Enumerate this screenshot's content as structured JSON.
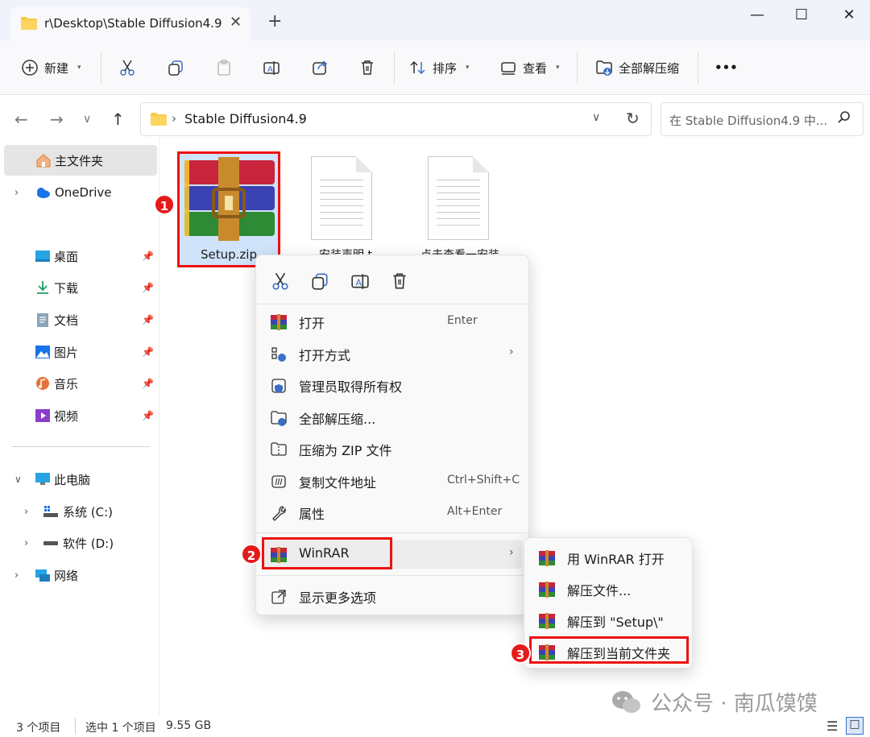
{
  "window": {
    "tab_title": "r\\Desktop\\Stable Diffusion4.9",
    "tab_close": "✕",
    "new_tab": "+",
    "minimize": "—",
    "maximize": "☐",
    "close": "✕"
  },
  "toolbar": {
    "new_label": "新建",
    "sort_label": "排序",
    "view_label": "查看",
    "extract_all_label": "全部解压缩",
    "more_label": "•••"
  },
  "address": {
    "crumb": "Stable Diffusion4.9",
    "search_placeholder": "在 Stable Diffusion4.9 中..."
  },
  "sidebar": {
    "home": "主文件夹",
    "onedrive": "OneDrive",
    "desktop": "桌面",
    "downloads": "下载",
    "documents": "文档",
    "pictures": "图片",
    "music": "音乐",
    "videos": "视频",
    "this_pc": "此电脑",
    "drive_c": "系统 (C:)",
    "drive_d": "软件 (D:)",
    "network": "网络"
  },
  "files": {
    "setup": "Setup.zip",
    "file2_partial": "安装声明.t",
    "file3_partial": "点击查看一安装"
  },
  "badges": [
    "1",
    "2",
    "3"
  ],
  "context_menu": {
    "open": "打开",
    "open_shortcut": "Enter",
    "open_with": "打开方式",
    "take_ownership": "管理员取得所有权",
    "extract_all": "全部解压缩...",
    "compress_zip": "压缩为 ZIP 文件",
    "copy_path": "复制文件地址",
    "copy_path_shortcut": "Ctrl+Shift+C",
    "properties": "属性",
    "properties_shortcut": "Alt+Enter",
    "winrar": "WinRAR",
    "more_options": "显示更多选项"
  },
  "winrar_submenu": {
    "open_with_winrar": "用 WinRAR 打开",
    "extract_files": "解压文件...",
    "extract_to_setup": "解压到 \"Setup\\\"",
    "extract_here": "解压到当前文件夹"
  },
  "status": {
    "item_count": "3 个项目",
    "selected": "选中 1 个项目",
    "size": "9.55 GB"
  },
  "watermark": "公众号 · 南瓜馍馍",
  "colors": {
    "highlight_red": "#e11111",
    "selection_blue": "#cfe3fa",
    "folder_yellow": "#f8c84a"
  }
}
